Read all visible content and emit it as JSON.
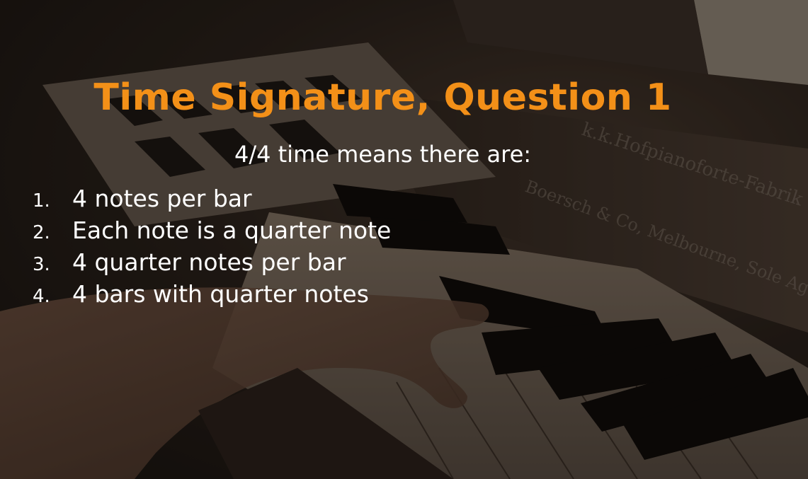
{
  "slide": {
    "title": "Time Signature, Question 1",
    "question": "4/4 time means there are:",
    "options": [
      {
        "number": "1.",
        "text": "4 notes per bar"
      },
      {
        "number": "2.",
        "text": "Each note is a quarter note"
      },
      {
        "number": "3.",
        "text": "4 quarter notes per bar"
      },
      {
        "number": "4.",
        "text": "4 bars with quarter notes"
      }
    ]
  },
  "background": {
    "image": "piano-keys-hands-photo",
    "brand_lettering": "k.k.Hofpianoforte-Fabrik · Wertheim, Boersch & Co, Melbourne, Sole Agents"
  },
  "colors": {
    "title": "#f39018",
    "text": "#ffffff",
    "background": "#1a1512"
  }
}
